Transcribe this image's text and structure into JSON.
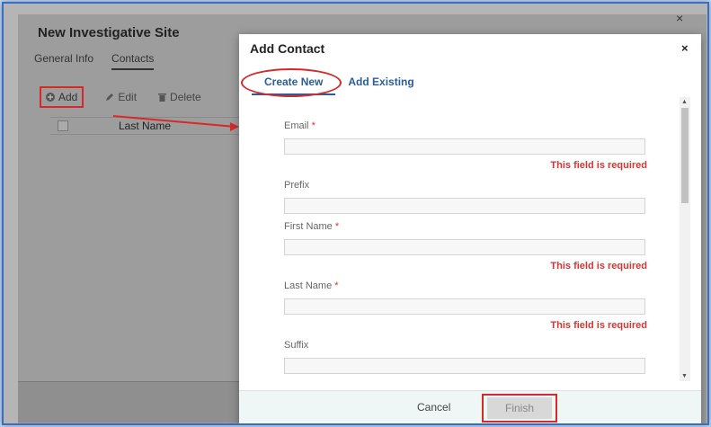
{
  "background": {
    "title": "New Investigative Site",
    "close_glyph": "×",
    "tabs": [
      {
        "label": "General Info",
        "active": false
      },
      {
        "label": "Contacts",
        "active": true
      }
    ],
    "toolbar": {
      "add_label": "Add",
      "edit_label": "Edit",
      "delete_label": "Delete"
    },
    "table": {
      "columns": [
        "Last Name"
      ]
    }
  },
  "modal": {
    "title": "Add Contact",
    "close_glyph": "×",
    "tabs": [
      {
        "label": "Create New",
        "active": true
      },
      {
        "label": "Add Existing",
        "active": false
      }
    ],
    "fields": [
      {
        "label": "Email",
        "required": true,
        "value": "",
        "error": "This field is required"
      },
      {
        "label": "Prefix",
        "required": false,
        "value": "",
        "error": ""
      },
      {
        "label": "First Name",
        "required": true,
        "value": "",
        "error": "This field is required"
      },
      {
        "label": "Last Name",
        "required": true,
        "value": "",
        "error": "This field is required"
      },
      {
        "label": "Suffix",
        "required": false,
        "value": "",
        "error": ""
      }
    ],
    "required_marker": "*",
    "footer": {
      "cancel_label": "Cancel",
      "finish_label": "Finish"
    }
  },
  "colors": {
    "accent": "#2a5d9a",
    "error": "#d33333",
    "highlight": "#d62a2a"
  },
  "icons": {
    "add": "plus-circle-icon",
    "edit": "pencil-icon",
    "delete": "trash-icon",
    "close": "close-icon",
    "scroll_up": "chevron-up-icon",
    "scroll_down": "chevron-down-icon"
  }
}
